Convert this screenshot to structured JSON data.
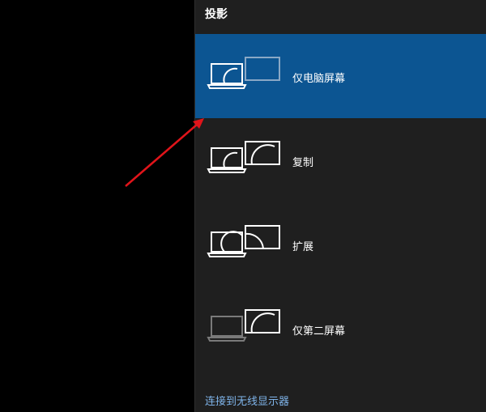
{
  "panel": {
    "title": "投影",
    "options": [
      {
        "label": "仅电脑屏幕",
        "icon": "pc-screen-only-icon",
        "selected": true
      },
      {
        "label": "复制",
        "icon": "duplicate-display-icon",
        "selected": false
      },
      {
        "label": "扩展",
        "icon": "extend-display-icon",
        "selected": false
      },
      {
        "label": "仅第二屏幕",
        "icon": "second-screen-only-icon",
        "selected": false
      }
    ],
    "connect_link": "连接到无线显示器"
  },
  "colors": {
    "panel_bg": "#1f1f1f",
    "selected_bg": "#0c5592",
    "link": "#7fb4ea",
    "annotation_arrow": "#e0141a"
  }
}
